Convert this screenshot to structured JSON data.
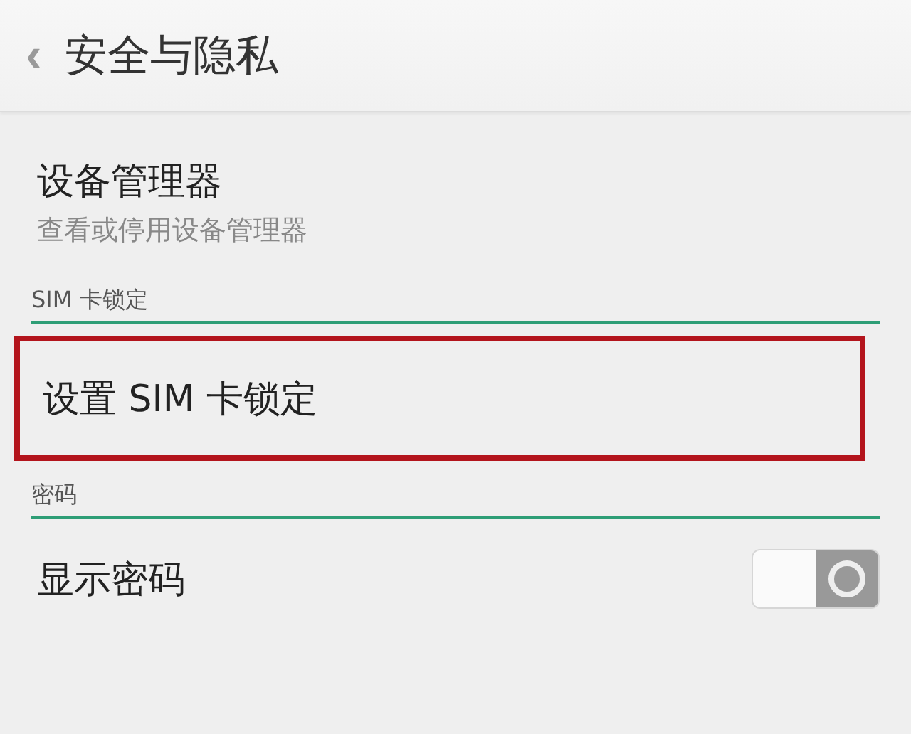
{
  "header": {
    "back_icon": "‹",
    "title": "安全与隐私"
  },
  "sections": [
    {
      "items": [
        {
          "kind": "link",
          "title": "设备管理器",
          "subtitle": "查看或停用设备管理器",
          "highlighted": false
        }
      ]
    },
    {
      "heading": "SIM 卡锁定",
      "items": [
        {
          "kind": "link",
          "title": "设置 SIM 卡锁定",
          "highlighted": true
        }
      ]
    },
    {
      "heading": "密码",
      "items": [
        {
          "kind": "switch",
          "title": "显示密码",
          "on": false,
          "highlighted": false
        }
      ]
    }
  ]
}
